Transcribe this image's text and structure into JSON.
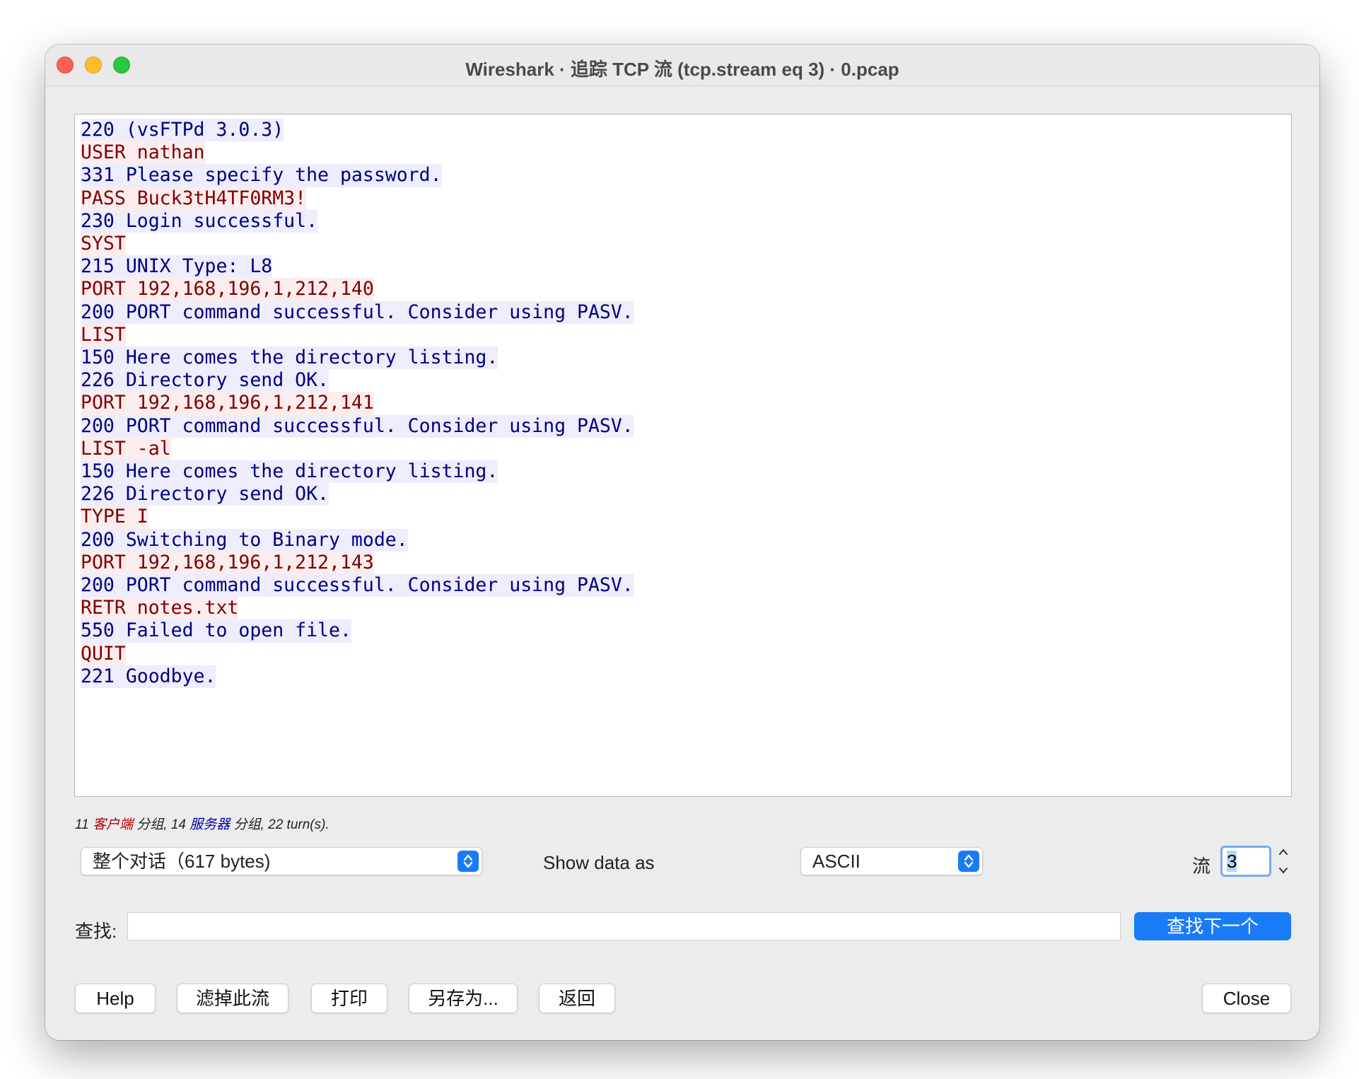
{
  "window": {
    "title": "Wireshark · 追踪 TCP 流 (tcp.stream eq 3) · 0.pcap"
  },
  "stream": {
    "lines": [
      {
        "dir": "server",
        "text": "220 (vsFTPd 3.0.3)"
      },
      {
        "dir": "client",
        "text": "USER nathan"
      },
      {
        "dir": "server",
        "text": "331 Please specify the password."
      },
      {
        "dir": "client",
        "text": "PASS Buck3tH4TF0RM3!"
      },
      {
        "dir": "server",
        "text": "230 Login successful."
      },
      {
        "dir": "client",
        "text": "SYST"
      },
      {
        "dir": "server",
        "text": "215 UNIX Type: L8"
      },
      {
        "dir": "client",
        "text": "PORT 192,168,196,1,212,140"
      },
      {
        "dir": "server",
        "text": "200 PORT command successful. Consider using PASV."
      },
      {
        "dir": "client",
        "text": "LIST"
      },
      {
        "dir": "server",
        "text": "150 Here comes the directory listing."
      },
      {
        "dir": "server",
        "text": "226 Directory send OK."
      },
      {
        "dir": "client",
        "text": "PORT 192,168,196,1,212,141"
      },
      {
        "dir": "server",
        "text": "200 PORT command successful. Consider using PASV."
      },
      {
        "dir": "client",
        "text": "LIST -al"
      },
      {
        "dir": "server",
        "text": "150 Here comes the directory listing."
      },
      {
        "dir": "server",
        "text": "226 Directory send OK."
      },
      {
        "dir": "client",
        "text": "TYPE I"
      },
      {
        "dir": "server",
        "text": "200 Switching to Binary mode."
      },
      {
        "dir": "client",
        "text": "PORT 192,168,196,1,212,143"
      },
      {
        "dir": "server",
        "text": "200 PORT command successful. Consider using PASV."
      },
      {
        "dir": "client",
        "text": "RETR notes.txt"
      },
      {
        "dir": "server",
        "text": "550 Failed to open file."
      },
      {
        "dir": "client",
        "text": "QUIT"
      },
      {
        "dir": "server",
        "text": "221 Goodbye."
      }
    ]
  },
  "summary": {
    "client_count": "11 ",
    "client_label": "客户端",
    "mid": " 分组, 14 ",
    "server_label": "服务器",
    "tail": " 分组, 22 turn(s)."
  },
  "controls": {
    "conversation_select": "整个对话（617 bytes)",
    "show_data_label": "Show data as",
    "show_data_value": "ASCII",
    "stream_label": "流",
    "stream_value": "3"
  },
  "search": {
    "label": "查找:",
    "value": "",
    "find_next": "查找下一个"
  },
  "buttons": {
    "help": "Help",
    "filter_out": "滤掉此流",
    "print": "打印",
    "save_as": "另存为...",
    "back": "返回",
    "close": "Close"
  },
  "colors": {
    "client_text": "#7f0000",
    "client_bg": "#fbeded",
    "server_text": "#000080",
    "server_bg": "#ededfb",
    "accent": "#1a7bf6"
  }
}
